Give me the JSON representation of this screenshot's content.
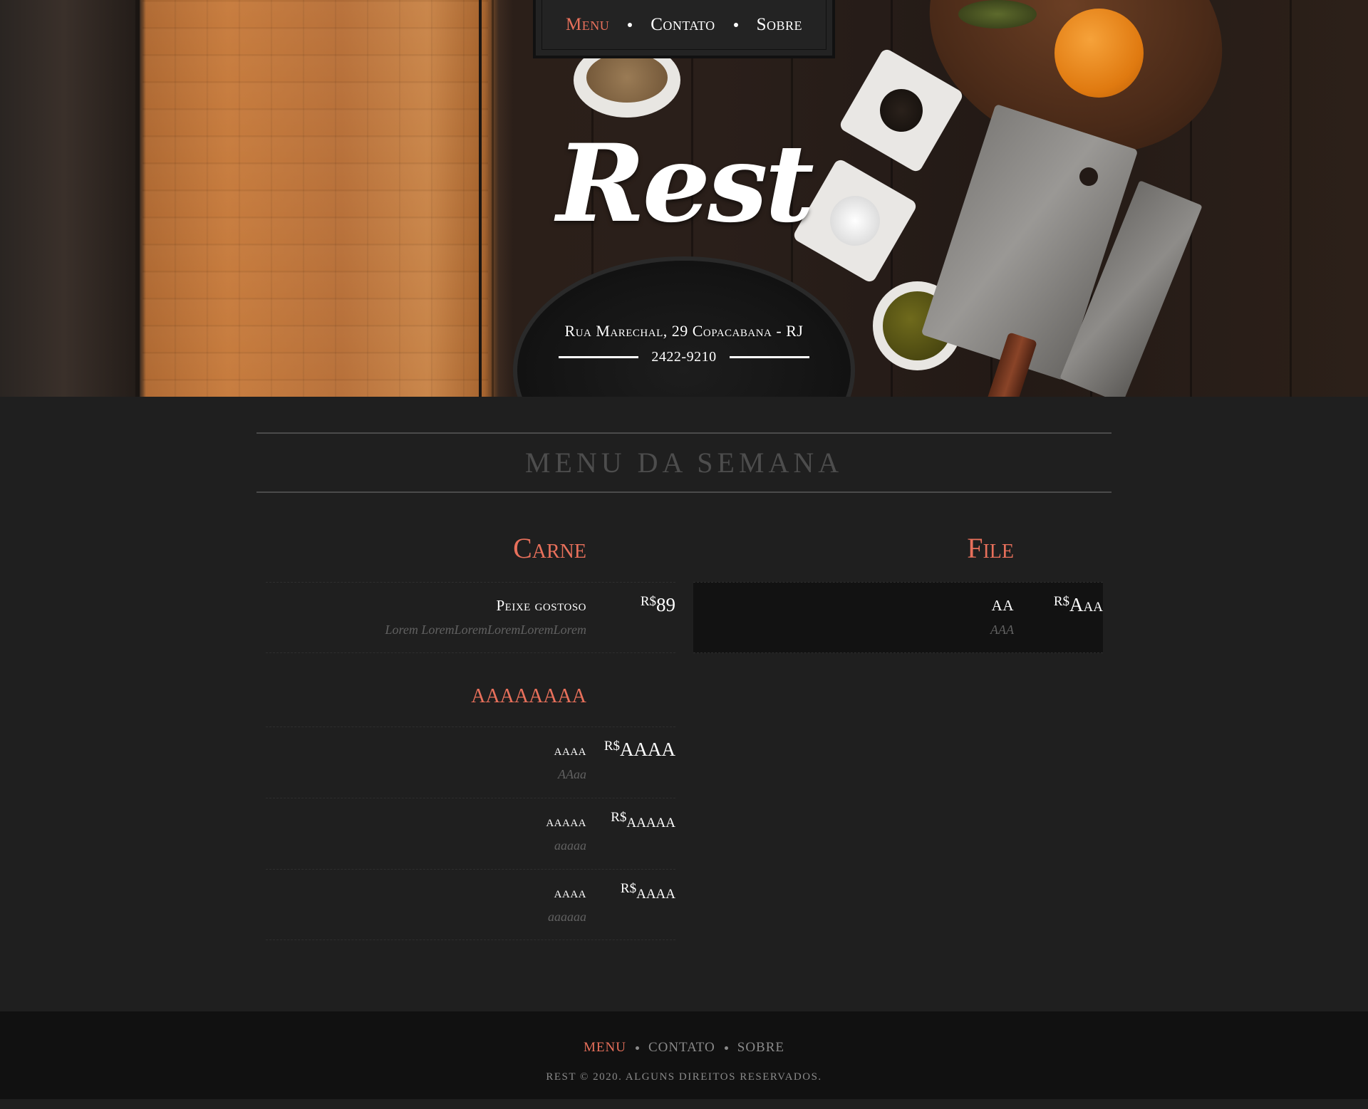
{
  "nav": {
    "items": [
      {
        "label": "Menu",
        "active": true
      },
      {
        "label": "Contato",
        "active": false
      },
      {
        "label": "Sobre",
        "active": false
      }
    ]
  },
  "hero": {
    "logo": "Rest",
    "address": "Rua Marechal, 29 Copacabana - RJ",
    "phone": "2422-9210"
  },
  "menu": {
    "title": "MENU DA SEMANA",
    "currency": "R$",
    "categories_left": [
      {
        "title": "Carne",
        "items": [
          {
            "name": "Peixe gostoso",
            "desc": "Lorem LoremLoremLoremLoremLorem",
            "price": "89"
          }
        ]
      },
      {
        "title": "aaaaaaaa",
        "items": [
          {
            "name": "aaaa",
            "desc": "AAaa",
            "price": "AAAA"
          },
          {
            "name": "aaaaa",
            "desc": "aaaaa",
            "price": "aaaaa"
          },
          {
            "name": "aaaa",
            "desc": "aaaaaa",
            "price": "aaaa"
          }
        ]
      }
    ],
    "categories_right": [
      {
        "title": "File",
        "items": [
          {
            "name": "AA",
            "desc": "AAA",
            "price": "Aaa"
          }
        ]
      }
    ]
  },
  "footer": {
    "nav": [
      "MENU",
      "CONTATO",
      "SOBRE"
    ],
    "copyright": "REST © 2020. ALGUNS DIREITOS RESERVADOS."
  },
  "colors": {
    "accent": "#e8705b",
    "background": "#1f1f1f",
    "footer": "#111111",
    "muted": "#616161"
  },
  "icons": {
    "separator": "dot-icon"
  }
}
